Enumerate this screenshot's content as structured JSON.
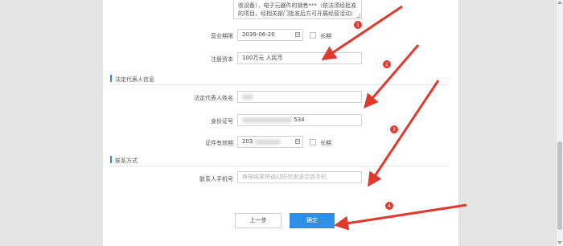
{
  "business_scope": {
    "line1": "收设备），电子元器件的销售***（依法须经批准",
    "line2": "的项目，经相关部门批准后方可开展经营活动）"
  },
  "business_term": {
    "label": "营业期限",
    "value": "2039-06-20",
    "long_term_label": "长期"
  },
  "registered_capital": {
    "label": "注册资本",
    "value": "100万元 人民币"
  },
  "legal_rep_section": {
    "title": "法定代表人信息",
    "name_label": "法定代表人姓名",
    "id_label": "身份证号",
    "id_value_visible": "534",
    "validity_label": "证件有效期",
    "validity_value_visible": "203",
    "long_term_label": "长期"
  },
  "contact_section": {
    "title": "联系方式",
    "phone_label": "联系人手机号",
    "phone_placeholder": "审核结果将通过短信发送至该手机"
  },
  "actions": {
    "prev_label": "上一步",
    "confirm_label": "确定"
  },
  "annotations": {
    "color": "#e03a2f",
    "markers": [
      "1",
      "2",
      "3",
      "4"
    ]
  }
}
